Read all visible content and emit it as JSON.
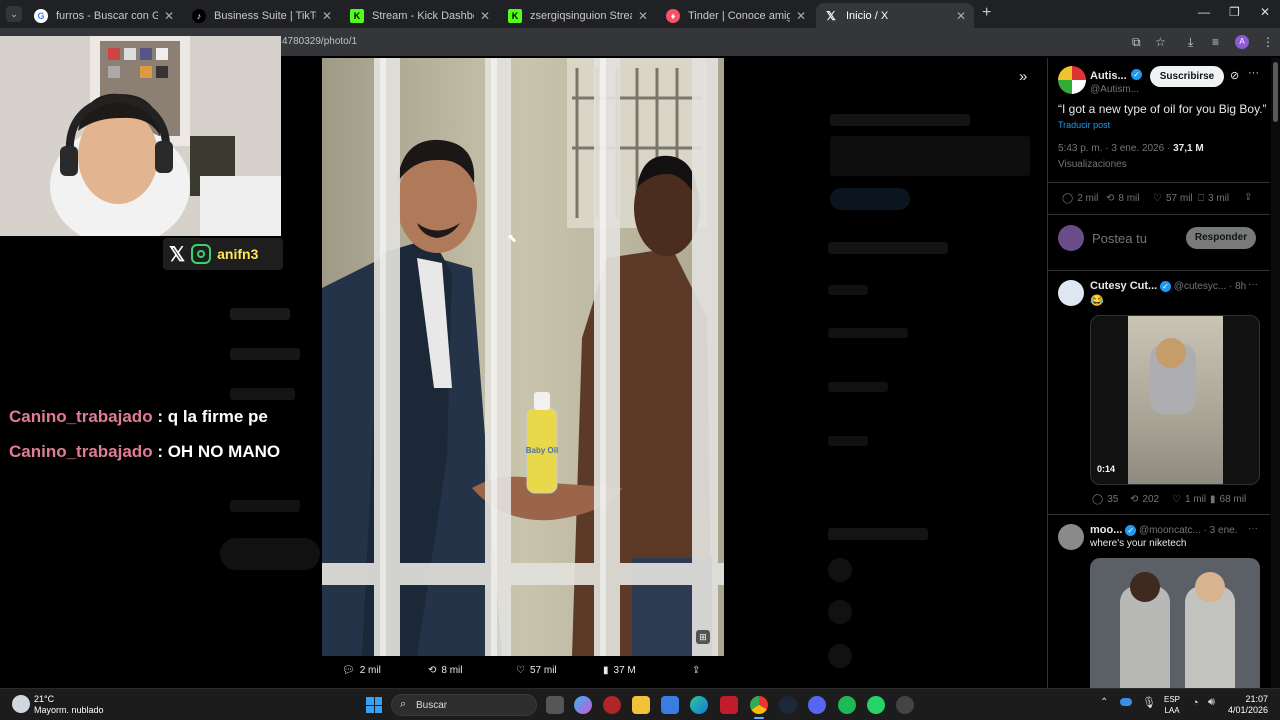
{
  "browser": {
    "tabs": [
      {
        "label": "furros - Buscar con Google",
        "icon": "google-icon",
        "color": "#ffffff"
      },
      {
        "label": "Business Suite | TikTok",
        "icon": "tiktok-icon",
        "color": "#000000"
      },
      {
        "label": "Stream - Kick Dashboard",
        "icon": "kick-icon",
        "color": "#53fc18"
      },
      {
        "label": "zsergiqsinguion Stream - Watch",
        "icon": "kick-icon",
        "color": "#53fc18"
      },
      {
        "label": "Tinder | Conoce amigos y gente",
        "icon": "tinder-icon",
        "color": "#fd5068"
      },
      {
        "label": "Inicio / X",
        "icon": "x-icon",
        "color": "#ffffff"
      }
    ],
    "url": "4780329/photo/1"
  },
  "overlay": {
    "social_handle": "anifn3",
    "chat": [
      {
        "user": "Canino_trabajado",
        "message": ": q la firme pe"
      },
      {
        "user": "Canino_trabajado",
        "message": ": OH NO MANO"
      }
    ]
  },
  "media": {
    "bottle_label": "Baby Oil",
    "actions": {
      "replies": "2 mil",
      "reposts": "8 mil",
      "likes": "57 mil",
      "views": "37 M"
    }
  },
  "post": {
    "author_name": "Autis...",
    "author_handle": "@Autism...",
    "subscribe_label": "Suscribirse",
    "text": "“I got a new type of oil for you Big Boy.”",
    "translate_label": "Traducir post",
    "time_date": "5:43 p. m. · 3 ene. 2026 · ",
    "views_count": "37,1 M",
    "views_label": "Visualizaciones",
    "stats": {
      "replies": "2 mil",
      "reposts": "8 mil",
      "likes": "57 mil",
      "bookmarks": "3 mil"
    },
    "reply_placeholder": "Postea tu",
    "reply_button": "Responder"
  },
  "replies": [
    {
      "name": "Cutesy Cut...",
      "handle": "@cutesyc...",
      "time": "· 8h",
      "text": "😂",
      "video_duration": "0:14",
      "stats": {
        "replies": "35",
        "reposts": "202",
        "likes": "1 mil",
        "views": "68 mil"
      }
    },
    {
      "name": "moo...",
      "handle": "@mooncatc...",
      "time": "· 3 ene.",
      "text": "where's your niketech"
    }
  ],
  "taskbar": {
    "weather_temp": "21°C",
    "weather_desc": "Mayorm. nublado",
    "search_label": "Buscar",
    "lang": "ESP",
    "lang_sub": "LAA",
    "time": "21:07",
    "date": "4/01/2026"
  }
}
